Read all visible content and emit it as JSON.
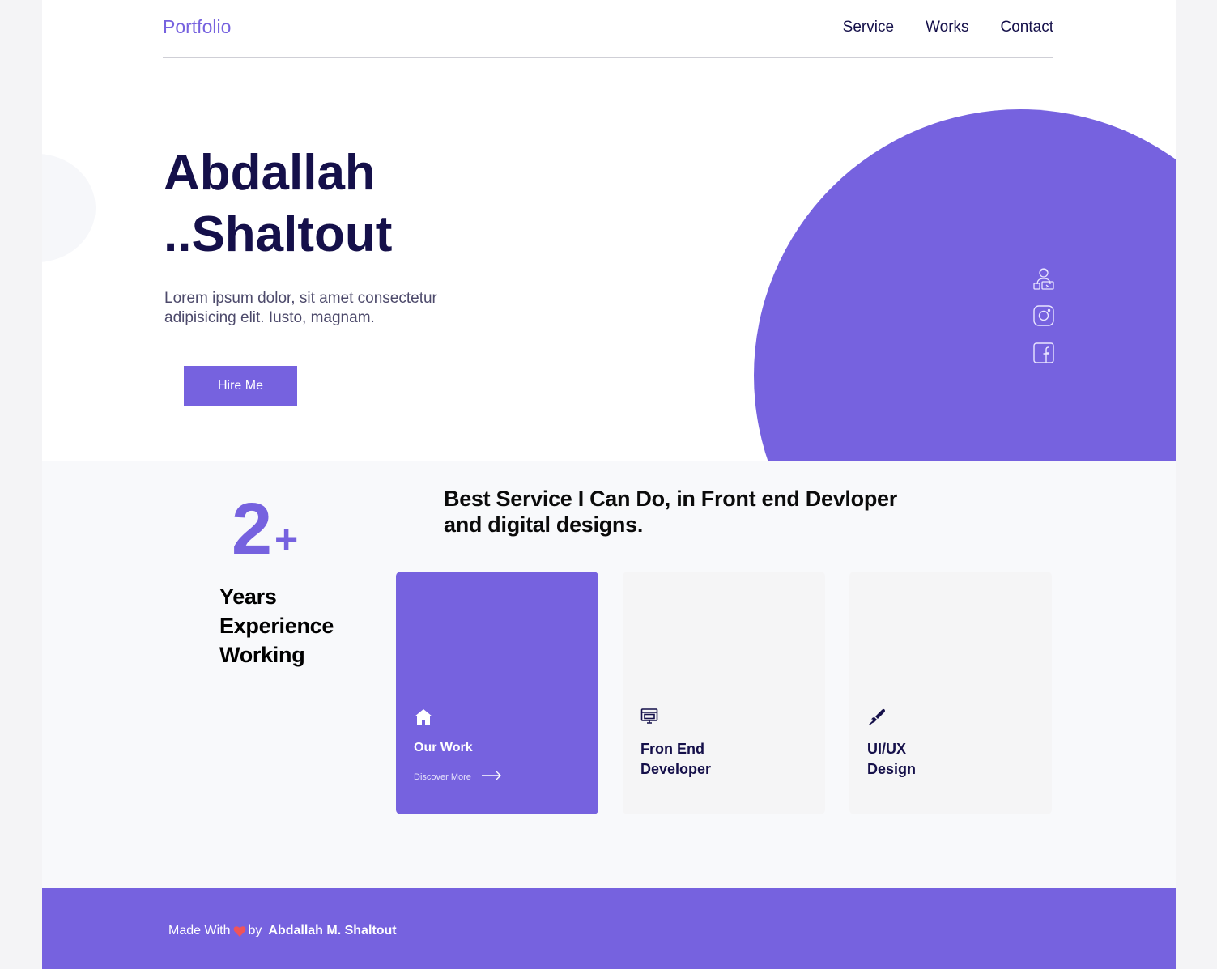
{
  "header": {
    "brand": "Portfolio",
    "nav": [
      "Service",
      "Works",
      "Contact"
    ]
  },
  "hero": {
    "title_line1": "Abdallah",
    "title_line2": "..Shaltout",
    "description": "Lorem ipsum dolor, sit amet consectetur adipisicing elit. Iusto, magnam.",
    "hire_button": "Hire Me",
    "social_icons": [
      "developer-icon",
      "instagram-icon",
      "facebook-icon"
    ]
  },
  "experience": {
    "number": "2",
    "plus": "+",
    "line1": "Years",
    "line2": "Experience",
    "line3": "Working"
  },
  "services": {
    "heading": "Best Service I Can Do, in Front end Devloper and digital designs.",
    "cards": [
      {
        "icon": "home-icon",
        "title_line1": "Our Work",
        "title_line2": "",
        "link": "Discover More",
        "link_icon": "arrow-right-icon"
      },
      {
        "icon": "monitor-code-icon",
        "title_line1": "Fron End",
        "title_line2": "Developer"
      },
      {
        "icon": "pen-nib-icon",
        "title_line1": "UI/UX",
        "title_line2": "Design"
      }
    ]
  },
  "footer": {
    "made_with": "Made With",
    "heart_icon": "heart-icon",
    "by": "by",
    "author": "Abdallah M. Shaltout"
  },
  "colors": {
    "accent": "#7662df",
    "heading": "#15104a",
    "heart": "#f0545a"
  }
}
